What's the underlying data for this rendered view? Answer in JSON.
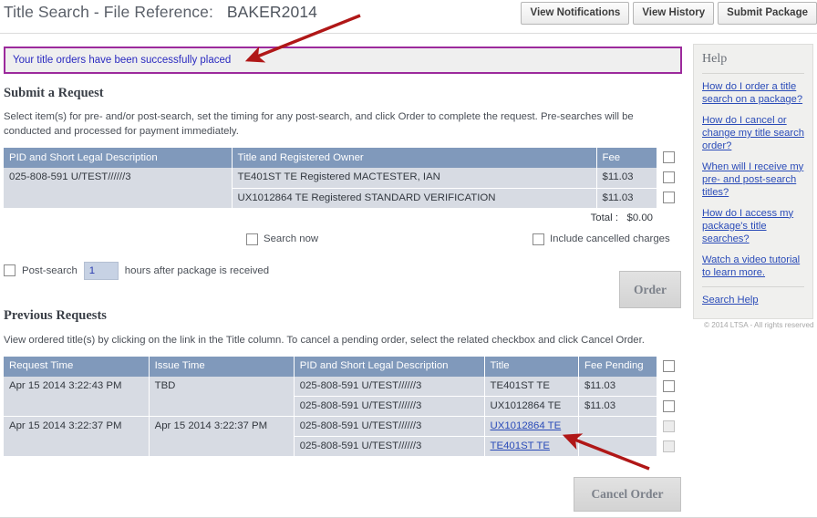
{
  "header": {
    "title_prefix": "Title Search - File Reference:",
    "file_reference": "BAKER2014",
    "buttons": [
      {
        "label": "View Notifications"
      },
      {
        "label": "View History"
      },
      {
        "label": "Submit Package"
      }
    ]
  },
  "alert": {
    "message": "Your title orders have been successfully placed"
  },
  "submit_request": {
    "heading": "Submit a Request",
    "description": "Select item(s) for pre- and/or post-search, set the timing for any post-search, and click Order to complete the request. Pre-searches will be conducted and processed for payment immediately.",
    "table": {
      "columns": [
        "PID and Short Legal Description",
        "Title and Registered Owner",
        "Fee"
      ],
      "rows": [
        {
          "pid": "025-808-591 U/TEST//////3",
          "title_owner": "TE401ST TE Registered MACTESTER, IAN",
          "fee": "$11.03",
          "checked": false
        },
        {
          "pid": "",
          "title_owner": "UX1012864 TE Registered STANDARD VERIFICATION",
          "fee": "$11.03",
          "checked": false
        }
      ]
    },
    "total_label": "Total :",
    "total_value": "$0.00",
    "search_now_label": "Search now",
    "include_cancelled_label": "Include cancelled charges",
    "post_search_label": "Post-search",
    "post_search_hours": "1",
    "post_search_suffix": "hours after package is received",
    "order_button": "Order"
  },
  "previous_requests": {
    "heading": "Previous Requests",
    "description": "View ordered title(s) by clicking on the link in the Title column. To cancel a pending order, select the related checkbox and click Cancel Order.",
    "table": {
      "columns": [
        "Request Time",
        "Issue Time",
        "PID and Short Legal Description",
        "Title",
        "Fee Pending"
      ],
      "rows": [
        {
          "request_time": "Apr 15 2014 3:22:43 PM",
          "issue_time": "TBD",
          "pid": "025-808-591 U/TEST//////3",
          "title": "TE401ST TE",
          "title_is_link": false,
          "fee_pending": "$11.03",
          "checkbox_disabled": false
        },
        {
          "request_time": "",
          "issue_time": "",
          "pid": "025-808-591 U/TEST//////3",
          "title": "UX1012864 TE",
          "title_is_link": false,
          "fee_pending": "$11.03",
          "checkbox_disabled": false
        },
        {
          "request_time": "Apr 15 2014 3:22:37 PM",
          "issue_time": "Apr 15 2014 3:22:37 PM",
          "pid": "025-808-591 U/TEST//////3",
          "title": "UX1012864 TE",
          "title_is_link": true,
          "fee_pending": "",
          "checkbox_disabled": true
        },
        {
          "request_time": "",
          "issue_time": "",
          "pid": "025-808-591 U/TEST//////3",
          "title": "TE401ST TE",
          "title_is_link": true,
          "fee_pending": "",
          "checkbox_disabled": true
        }
      ]
    },
    "cancel_button": "Cancel Order"
  },
  "help": {
    "title": "Help",
    "links": [
      "How do I order a title search on a package?",
      "How do I cancel or change my title search order?",
      "When will I receive my pre- and post-search titles?",
      "How do I access my package's title searches?",
      "Watch a video tutorial to learn more."
    ],
    "search_help": "Search Help",
    "copyright": "© 2014 LTSA - All rights reserved"
  },
  "colors": {
    "table_header": "#8099bb",
    "table_row": "#d7dbe3",
    "alert_border": "#9c2a9c",
    "alert_text": "#2a2ac0",
    "link": "#2a4bb8",
    "arrow": "#b01717"
  }
}
